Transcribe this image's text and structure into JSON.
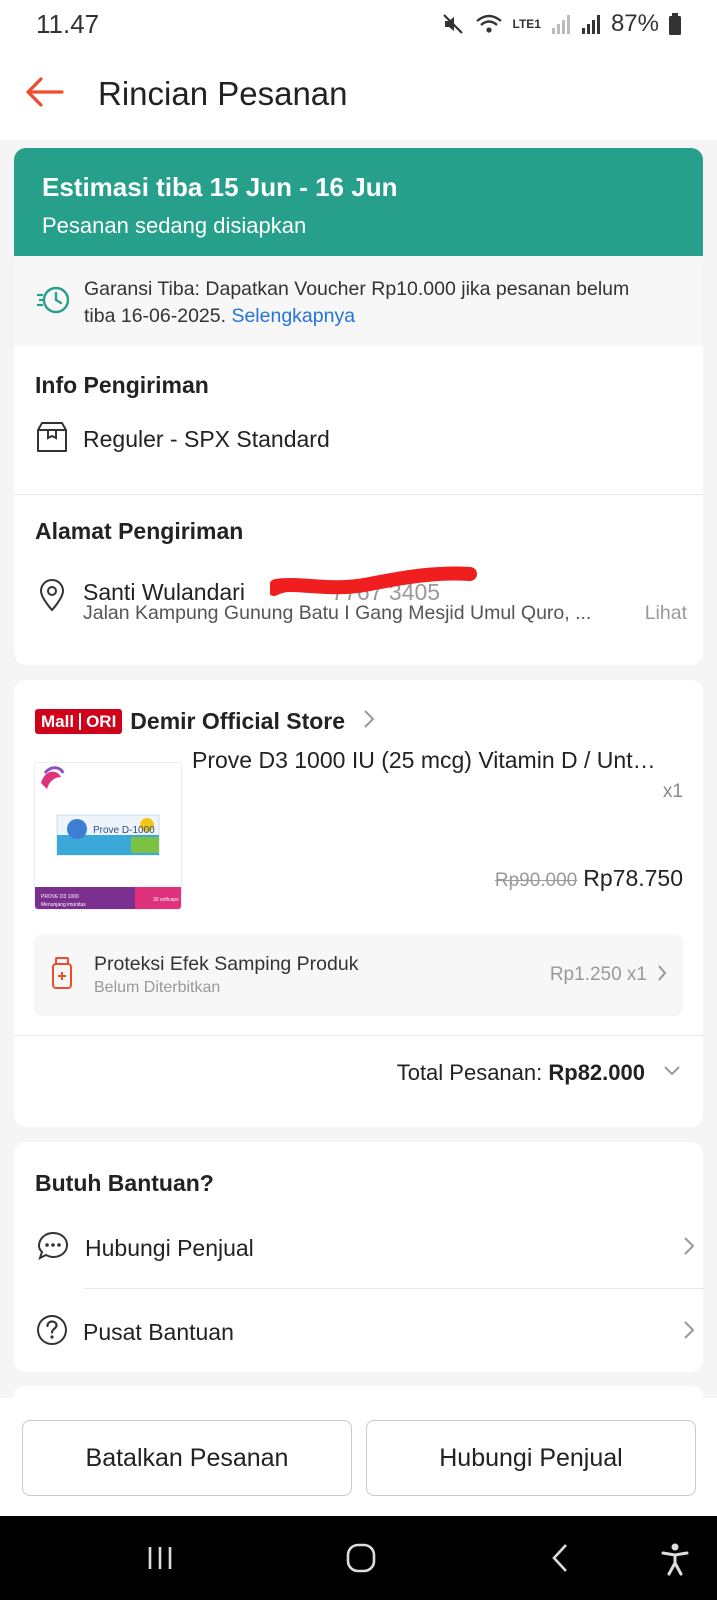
{
  "status_bar": {
    "time": "11.47",
    "network_label": "LTE1",
    "battery": "87%"
  },
  "header": {
    "title": "Rincian Pesanan",
    "back_icon": "arrow-left-icon",
    "accent_color": "#ee4d2d"
  },
  "delivery_banner": {
    "title": "Estimasi tiba 15 Jun - 16 Jun",
    "subtitle": "Pesanan sedang disiapkan",
    "color": "#26a08a"
  },
  "guarantee": {
    "text_line1": "Garansi Tiba: Dapatkan Voucher Rp10.000 jika pesanan belum",
    "text_line2": "tiba 16-06-2025. ",
    "link": "Selengkapnya",
    "link_color": "#2673d9"
  },
  "shipping_info": {
    "title": "Info Pengiriman",
    "method": "Reguler - SPX Standard"
  },
  "address": {
    "title": "Alamat Pengiriman",
    "name": "Santi Wulandari",
    "phone_partial": "7767 3405",
    "street": "Jalan Kampung Gunung Batu I Gang Mesjid Umul Quro, ...",
    "more_link": "Lihat"
  },
  "store": {
    "badge_left": "Mall",
    "badge_right": "ORI",
    "name": "Demir Official Store"
  },
  "product": {
    "name": "Prove D3 1000 IU (25 mcg) Vitamin D / Unt…",
    "quantity": "x1",
    "original_price": "Rp90.000",
    "price": "Rp78.750",
    "thumb_label_1": "Prove D-1000",
    "thumb_label_2": "PROVE D3 1000",
    "thumb_label_3": "Menunjang imunitas",
    "thumb_label_4": "30 softcaps"
  },
  "protection": {
    "title": "Proteksi Efek Samping Produk",
    "status": "Belum Diterbitkan",
    "price": "Rp1.250 x1"
  },
  "order_total": {
    "label": "Total Pesanan: ",
    "value": "Rp82.000"
  },
  "help": {
    "title": "Butuh Bantuan?",
    "contact_seller": "Hubungi Penjual",
    "help_center": "Pusat Bantuan"
  },
  "bottom_actions": {
    "cancel": "Batalkan Pesanan",
    "contact": "Hubungi Penjual"
  }
}
